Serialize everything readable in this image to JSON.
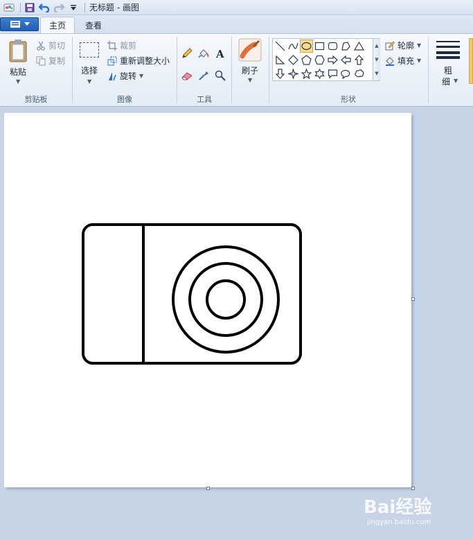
{
  "window": {
    "title": "无标题 - 画图",
    "quick_access": [
      "save-icon",
      "undo-icon",
      "redo-icon",
      "customize-icon"
    ]
  },
  "tabs": {
    "home": "主页",
    "view": "查看"
  },
  "ribbon": {
    "clipboard": {
      "group_label": "剪贴板",
      "paste": "粘贴",
      "cut": "剪切",
      "copy": "复制"
    },
    "image": {
      "group_label": "图像",
      "select": "选择",
      "crop": "裁剪",
      "resize": "重新调整大小",
      "rotate": "旋转"
    },
    "tools": {
      "group_label": "工具",
      "items": [
        "pencil-icon",
        "fill-icon",
        "text-icon",
        "eraser-icon",
        "color-picker-icon",
        "magnifier-icon"
      ]
    },
    "brushes": {
      "label": "刷子"
    },
    "shapes": {
      "group_label": "形状",
      "outline": "轮廓",
      "fill": "填充",
      "selected": "oval"
    },
    "size": {
      "label_line1": "粗",
      "label_line2": "细"
    }
  },
  "drawing": {
    "description_colors": {
      "stroke": "#000000",
      "background": "#ffffff"
    }
  },
  "watermark": {
    "brand": "Bai经验",
    "url": "jingyan.baidu.com"
  },
  "colors": {
    "accent": "#1f5fb5",
    "ribbon_bg": "#e8eff8",
    "workspace": "#c7d4e6",
    "selected_shape": "#fbdc8d"
  }
}
